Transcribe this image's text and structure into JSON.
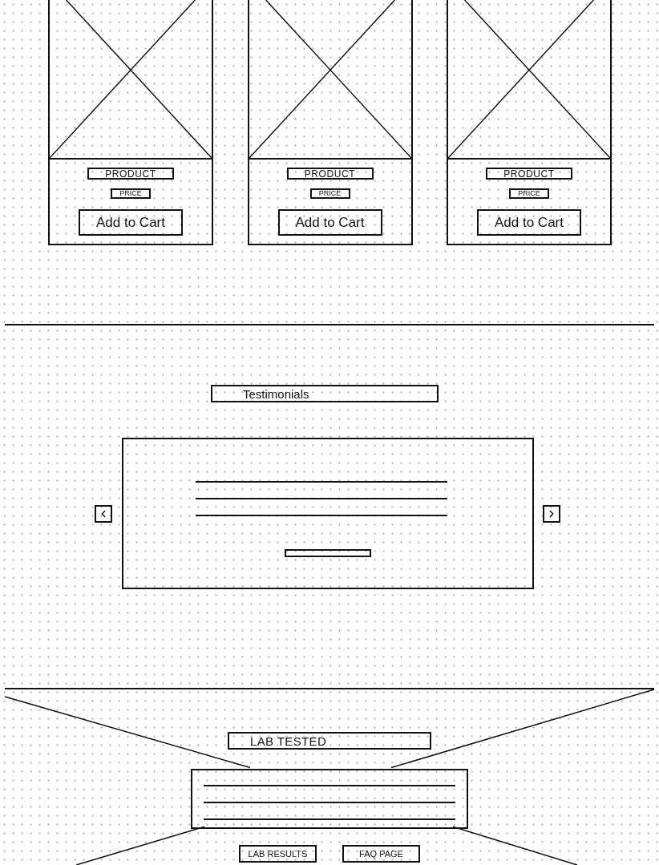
{
  "products": [
    {
      "name": "PRODUCT",
      "price": "PRICE",
      "button": "Add to Cart"
    },
    {
      "name": "PRODUCT",
      "price": "PRICE",
      "button": "Add to Cart"
    },
    {
      "name": "PRODUCT",
      "price": "PRICE",
      "button": "Add to Cart"
    }
  ],
  "testimonials": {
    "title": "Testimonials"
  },
  "lab_section": {
    "title": "LAB TESTED",
    "links": [
      "LAB RESULTS",
      "FAQ PAGE"
    ]
  }
}
